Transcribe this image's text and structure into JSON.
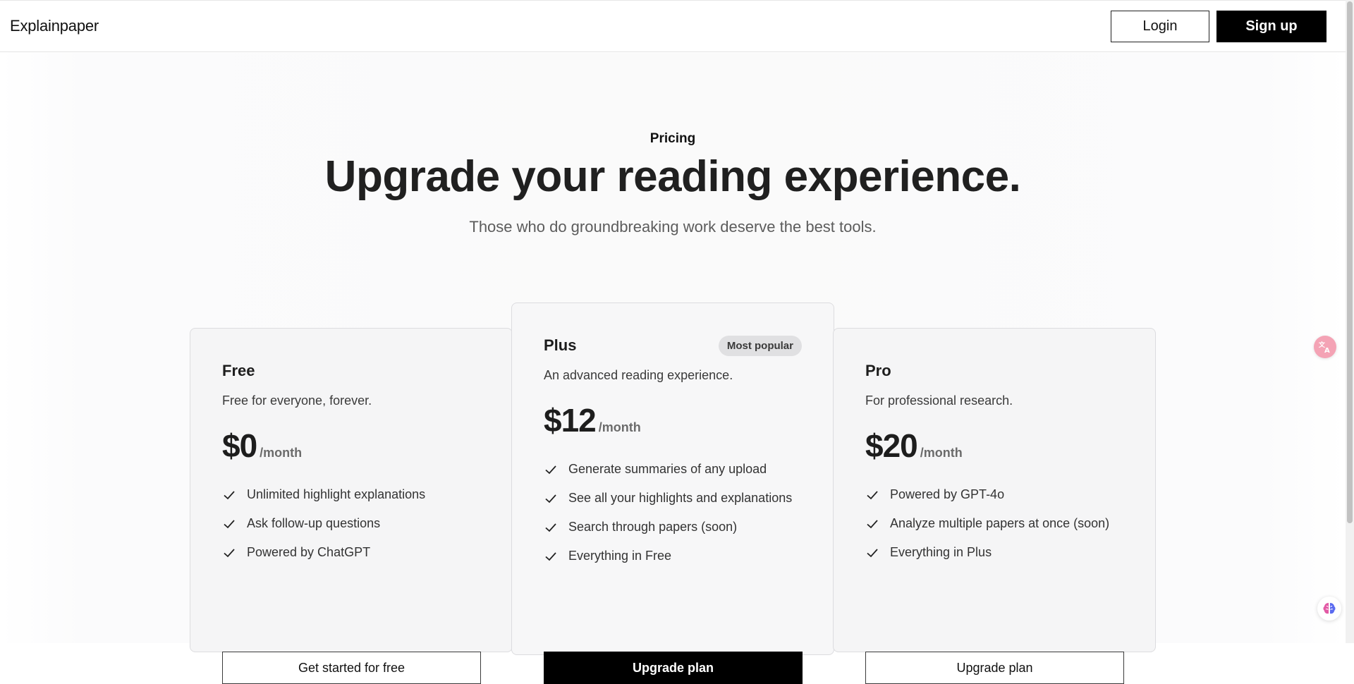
{
  "header": {
    "logo": "Explainpaper",
    "login_label": "Login",
    "signup_label": "Sign up"
  },
  "hero": {
    "eyebrow": "Pricing",
    "headline": "Upgrade your reading experience.",
    "subhead": "Those who do groundbreaking work deserve the best tools."
  },
  "plans": [
    {
      "name": "Free",
      "description": "Free for everyone, forever.",
      "price": "$0",
      "period": "/month",
      "features": [
        "Unlimited highlight explanations",
        "Ask follow-up questions",
        "Powered by ChatGPT"
      ],
      "cta": "Get started for free"
    },
    {
      "name": "Plus",
      "badge": "Most popular",
      "description": "An advanced reading experience.",
      "price": "$12",
      "period": "/month",
      "features": [
        "Generate summaries of any upload",
        "See all your highlights and explanations",
        "Search through papers (soon)",
        "Everything in Free"
      ],
      "cta": "Upgrade plan"
    },
    {
      "name": "Pro",
      "description": "For professional research.",
      "price": "$20",
      "period": "/month",
      "features": [
        "Powered by GPT-4o",
        "Analyze multiple papers at once (soon)",
        "Everything in Plus"
      ],
      "cta": "Upgrade plan"
    }
  ],
  "floating": {
    "translate_icon": "translate-icon",
    "brain_icon": "brain-icon"
  },
  "colors": {
    "primary": "#000000",
    "card_bg": "#f5f5f6",
    "badge_bg": "#e0e0e2",
    "translate_bubble": "#f4a3b5"
  }
}
